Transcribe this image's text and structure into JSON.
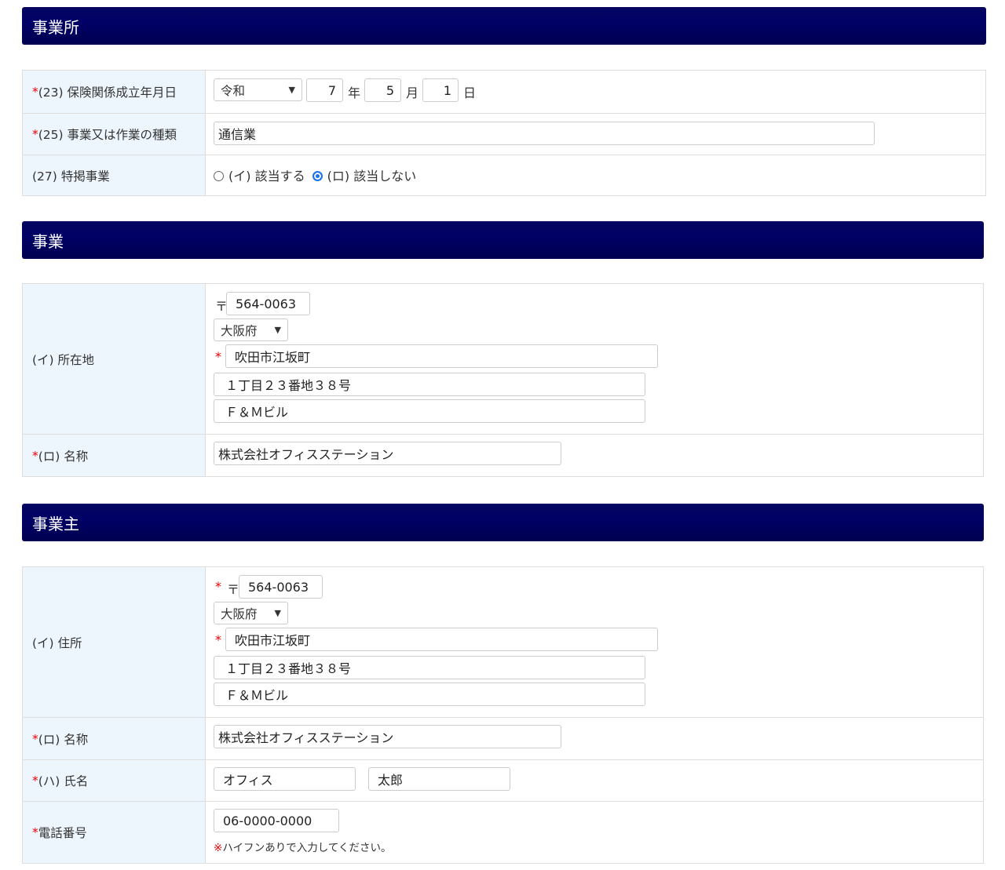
{
  "office": {
    "title": "事業所",
    "date": {
      "label": "(23) 保険関係成立年月日",
      "era": "令和",
      "year": "7",
      "year_unit": "年",
      "month": "5",
      "month_unit": "月",
      "day": "1",
      "day_unit": "日"
    },
    "business_type": {
      "label": "(25) 事業又は作業の種類",
      "value": "通信業"
    },
    "special": {
      "label": "(27) 特掲事業",
      "opt1": "(イ) 該当する",
      "opt2": "(ロ) 該当しない",
      "selected": "opt2"
    }
  },
  "business": {
    "title": "事業",
    "address": {
      "label": "(イ) 所在地",
      "postal_mark": "〒",
      "postal": "564-0063",
      "prefecture": "大阪府",
      "city": "吹田市江坂町",
      "line2": "１丁目２３番地３８号",
      "line3": "Ｆ＆Ｍビル"
    },
    "name": {
      "label": "(ロ) 名称",
      "value": "株式会社オフィスステーション"
    }
  },
  "owner": {
    "title": "事業主",
    "address": {
      "label": "(イ) 住所",
      "postal_mark": "〒",
      "postal": "564-0063",
      "prefecture": "大阪府",
      "city": "吹田市江坂町",
      "line2": "１丁目２３番地３８号",
      "line3": "Ｆ＆Ｍビル"
    },
    "name": {
      "label": "(ロ) 名称",
      "value": "株式会社オフィスステーション"
    },
    "person": {
      "label": "(ハ) 氏名",
      "last": "オフィス",
      "first": "太郎"
    },
    "phone": {
      "label": "電話番号",
      "value": "06-0000-0000",
      "note_mark": "※",
      "note": "ハイフンありで入力してください。"
    }
  },
  "required_mark": "*"
}
